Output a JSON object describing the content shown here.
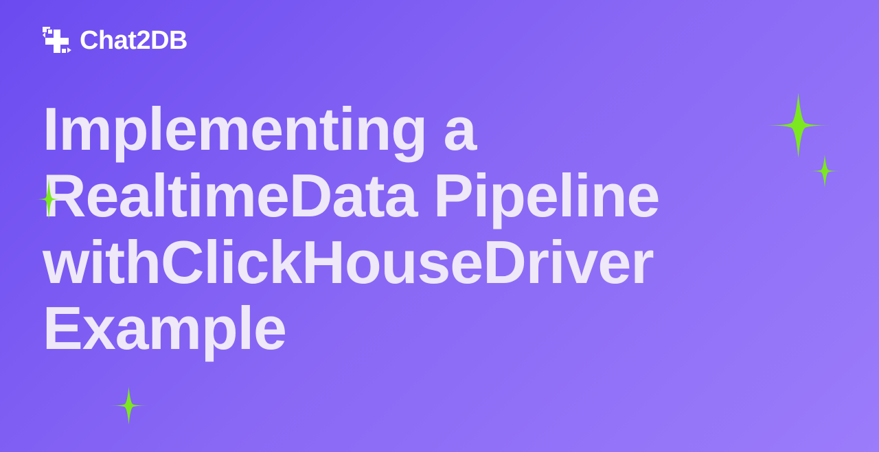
{
  "logo": {
    "text": "Chat2DB"
  },
  "title": "Implementing a RealtimeData Pipeline withClickHouseDriver Example",
  "colors": {
    "sparkle": "#7BE820",
    "text": "#EEE8F9",
    "logo": "#FFFFFF"
  }
}
